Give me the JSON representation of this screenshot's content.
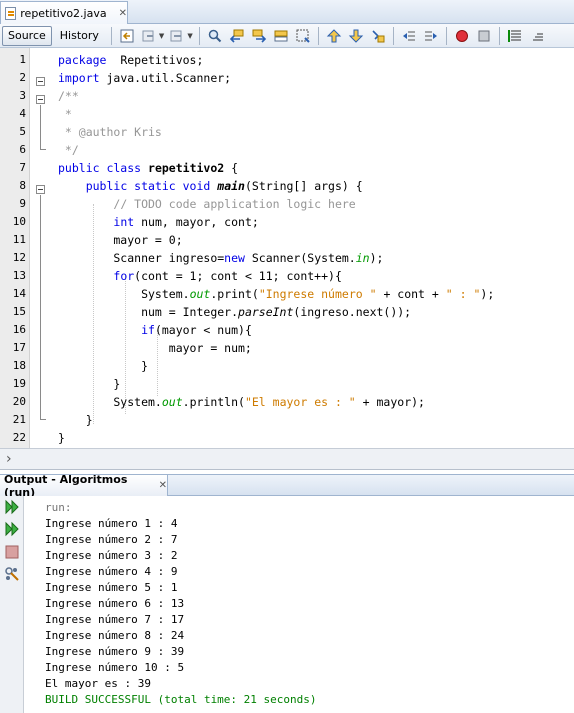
{
  "editor_tab": {
    "filename": "repetitivo2.java",
    "close": "✕"
  },
  "toolbar": {
    "source_label": "Source",
    "history_label": "History"
  },
  "code": [
    {
      "n": "1",
      "parts": [
        [
          "kw",
          "package"
        ],
        [
          "",
          "  Repetitivos;"
        ]
      ]
    },
    {
      "n": "2",
      "parts": [
        [
          "kw",
          "import"
        ],
        [
          "",
          " java.util.Scanner;"
        ]
      ]
    },
    {
      "n": "3",
      "parts": [
        [
          "com",
          "/**"
        ]
      ]
    },
    {
      "n": "4",
      "parts": [
        [
          "com",
          " *"
        ]
      ]
    },
    {
      "n": "5",
      "parts": [
        [
          "com",
          " * @author Kris"
        ]
      ]
    },
    {
      "n": "6",
      "parts": [
        [
          "com",
          " */"
        ]
      ]
    },
    {
      "n": "7",
      "parts": [
        [
          "kw",
          "public class"
        ],
        [
          "",
          " "
        ],
        [
          "bold",
          "repetitivo2"
        ],
        [
          "",
          " {"
        ]
      ]
    },
    {
      "n": "8",
      "parts": [
        [
          "",
          "    "
        ],
        [
          "kw",
          "public static void"
        ],
        [
          "",
          " "
        ],
        [
          "mth",
          "main"
        ],
        [
          "",
          "(String[] args) {"
        ]
      ]
    },
    {
      "n": "9",
      "parts": [
        [
          "",
          "        "
        ],
        [
          "com",
          "// TODO code application logic here"
        ]
      ]
    },
    {
      "n": "10",
      "parts": [
        [
          "",
          "        "
        ],
        [
          "kw",
          "int"
        ],
        [
          "",
          " num, mayor, cont;"
        ]
      ]
    },
    {
      "n": "11",
      "parts": [
        [
          "",
          "        mayor = 0;"
        ]
      ]
    },
    {
      "n": "12",
      "parts": [
        [
          "",
          "        Scanner ingreso="
        ],
        [
          "kw",
          "new"
        ],
        [
          "",
          " Scanner(System."
        ],
        [
          "fld",
          "in"
        ],
        [
          "",
          ");"
        ]
      ]
    },
    {
      "n": "13",
      "parts": [
        [
          "",
          "        "
        ],
        [
          "kw",
          "for"
        ],
        [
          "",
          "(cont = 1; cont < 11; cont++){"
        ]
      ]
    },
    {
      "n": "14",
      "parts": [
        [
          "",
          "            System."
        ],
        [
          "fld",
          "out"
        ],
        [
          "",
          ".print("
        ],
        [
          "str",
          "\"Ingrese número \""
        ],
        [
          "",
          " + cont + "
        ],
        [
          "str",
          "\" : \""
        ],
        [
          "",
          ");"
        ]
      ]
    },
    {
      "n": "15",
      "parts": [
        [
          "",
          "            num = Integer."
        ],
        [
          "itl",
          "parseInt"
        ],
        [
          "",
          "(ingreso.next());"
        ]
      ]
    },
    {
      "n": "16",
      "parts": [
        [
          "",
          "            "
        ],
        [
          "kw",
          "if"
        ],
        [
          "",
          "(mayor < num){"
        ]
      ]
    },
    {
      "n": "17",
      "parts": [
        [
          "",
          "                mayor = num;"
        ]
      ]
    },
    {
      "n": "18",
      "parts": [
        [
          "",
          "            }"
        ]
      ]
    },
    {
      "n": "19",
      "parts": [
        [
          "",
          "        }"
        ]
      ]
    },
    {
      "n": "20",
      "parts": [
        [
          "",
          "        System."
        ],
        [
          "fld",
          "out"
        ],
        [
          "",
          ".println("
        ],
        [
          "str",
          "\"El mayor es : \""
        ],
        [
          "",
          " + mayor);"
        ]
      ]
    },
    {
      "n": "21",
      "parts": [
        [
          "",
          "    }"
        ]
      ]
    },
    {
      "n": "22",
      "parts": [
        [
          "",
          "}"
        ]
      ]
    }
  ],
  "output": {
    "tab_label": "Output - Algoritmos (run)",
    "close": "✕",
    "lines": [
      {
        "cls": "run",
        "text": "run:"
      },
      {
        "cls": "",
        "text": "Ingrese número 1 : 4"
      },
      {
        "cls": "",
        "text": "Ingrese número 2 : 7"
      },
      {
        "cls": "",
        "text": "Ingrese número 3 : 2"
      },
      {
        "cls": "",
        "text": "Ingrese número 4 : 9"
      },
      {
        "cls": "",
        "text": "Ingrese número 5 : 1"
      },
      {
        "cls": "",
        "text": "Ingrese número 6 : 13"
      },
      {
        "cls": "",
        "text": "Ingrese número 7 : 17"
      },
      {
        "cls": "",
        "text": "Ingrese número 8 : 24"
      },
      {
        "cls": "",
        "text": "Ingrese número 9 : 39"
      },
      {
        "cls": "",
        "text": "Ingrese número 10 : 5"
      },
      {
        "cls": "",
        "text": "El mayor es : 39"
      },
      {
        "cls": "ok",
        "text": "BUILD SUCCESSFUL (total time: 21 seconds)"
      }
    ]
  },
  "colors": {
    "keyword": "#0000e6",
    "comment": "#969696",
    "string": "#ce7b00",
    "field": "#009900",
    "success": "#008000"
  }
}
